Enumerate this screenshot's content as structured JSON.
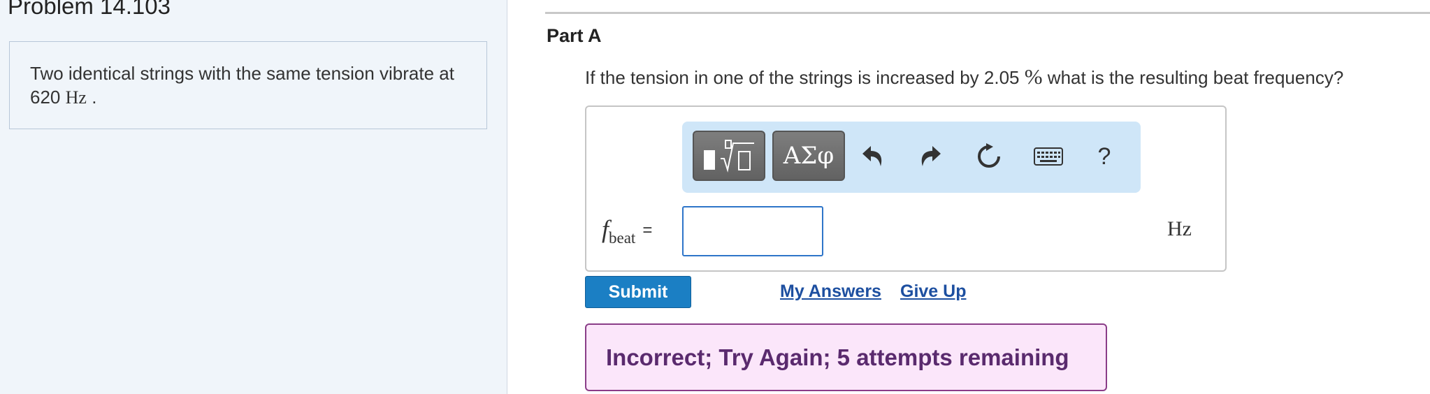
{
  "problem": {
    "title": "Problem 14.103",
    "text_prefix": "Two identical strings with the same tension vibrate at 620",
    "text_unit": "Hz",
    "text_suffix": "."
  },
  "part": {
    "title": "Part A",
    "question_prefix": "If the tension in one of the strings is increased by 2.05",
    "question_percent": "%",
    "question_suffix": "what is the resulting beat frequency?"
  },
  "toolbar": {
    "greek_label": "ΑΣφ",
    "help_label": "?",
    "icons": [
      "templates-icon",
      "greek-icon",
      "undo-icon",
      "redo-icon",
      "reset-icon",
      "keyboard-icon",
      "help-icon"
    ]
  },
  "answer": {
    "variable": "f",
    "subscript": "beat",
    "equals": "=",
    "value": "",
    "unit": "Hz"
  },
  "actions": {
    "submit_label": "Submit",
    "my_answers_label": "My Answers",
    "give_up_label": "Give Up"
  },
  "feedback": {
    "message": "Incorrect; Try Again; 5 attempts remaining"
  },
  "colors": {
    "left_panel_bg": "#f0f5fa",
    "toolbar_bg": "#cfe6f8",
    "submit_bg": "#1b7fc4",
    "link": "#1d4fa0",
    "feedback_bg": "#fbe6fa",
    "feedback_border": "#8a3d88",
    "feedback_text": "#5a2a6e"
  }
}
